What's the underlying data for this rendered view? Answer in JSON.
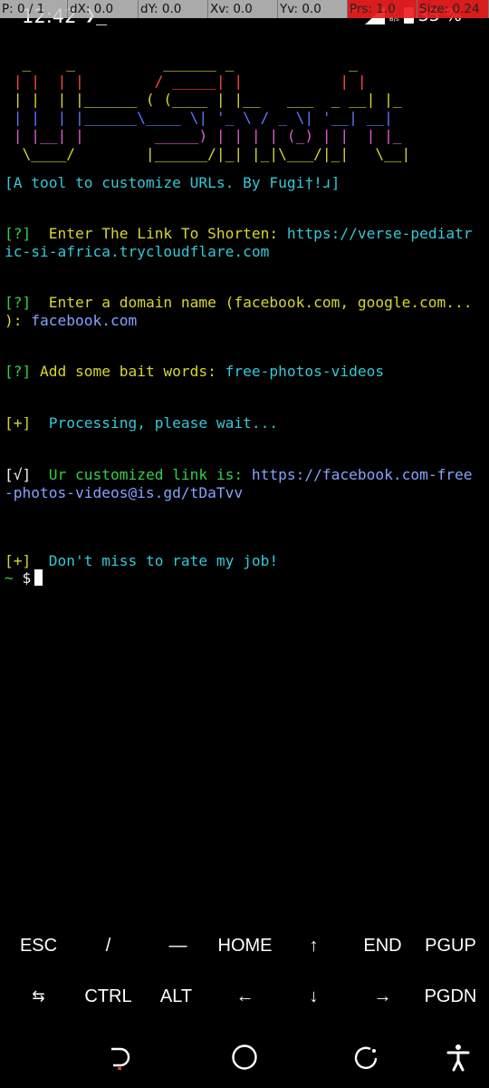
{
  "status_bar": {
    "time": "12:42",
    "terminal_glyph": "❯_",
    "network": "4G",
    "speed_value": "0",
    "speed_unit": "B/s",
    "battery": "35 %"
  },
  "pointer_overlay": [
    "P: 0 / 1",
    "dX: 0.0",
    "dY: 0.0",
    "Xv: 0.0",
    "Yv: 0.0",
    "Prs: 1.0",
    "Size: 0.24"
  ],
  "terminal": {
    "banner": [
      "  _    _          ______ _             _   ",
      " | |  | |        / _____| |           | |  ",
      " | |  | |______ ( (____ | |__   ___  _ __| |_ ",
      " | |  | |______\\____ \\| '_ \\ / _ \\| '__| __|",
      " | |__| |        _____) | | | | (_) | |  | |_ ",
      "  \\____/        |______/|_| |_|\\___/|_|   \\__|"
    ],
    "tagline": "[A tool to customize URLs. By Fugi†!ɹ]",
    "q1_tag": "[?]",
    "q1_prompt": "  Enter The Link To Shorten: ",
    "q1_answer_a": "https://verse-pediatr",
    "q1_answer_b": "ic-si-africa.trycloudflare.com",
    "q2_tag": "[?]",
    "q2_prompt_a": "  Enter a domain name (facebook.com, google.com...",
    "q2_prompt_b": "): ",
    "q2_answer": "facebook.com",
    "q3_tag": "[?]",
    "q3_prompt": " Add some bait words: ",
    "q3_answer": "free-photos-videos",
    "processing_tag": "[+]",
    "processing_text": "  Processing, please wait...",
    "result_tag": "[√]",
    "result_label": "  Ur customized link is: ",
    "result_link_a": "https://facebook.com-free",
    "result_link_b": "-photos-videos@is.gd/tDaTvv",
    "rate_tag": "[+]",
    "rate_text": "  Don't miss to rate my job!",
    "prompt_tilde": "~",
    "prompt_dollar": " $"
  },
  "extra_keys": {
    "row1": [
      "ESC",
      "/",
      "—",
      "HOME",
      "↑",
      "END",
      "PGUP"
    ],
    "row2": [
      "⇆",
      "CTRL",
      "ALT",
      "←",
      "↓",
      "→",
      "PGDN"
    ]
  },
  "nav_icons": [
    "back-icon",
    "home-circle-icon",
    "recents-icon",
    "accessibility-icon"
  ],
  "colors": {
    "background": "#000000",
    "banner_lines": [
      "#d6d630",
      "#ff4444",
      "#d6d630",
      "#5c78ff",
      "#e05ad6",
      "#d6d630"
    ],
    "cyan": "#33c8d8",
    "yellow": "#d6d630",
    "link": "#86a2ff",
    "overlay_highlight": "#eb1e1e"
  }
}
